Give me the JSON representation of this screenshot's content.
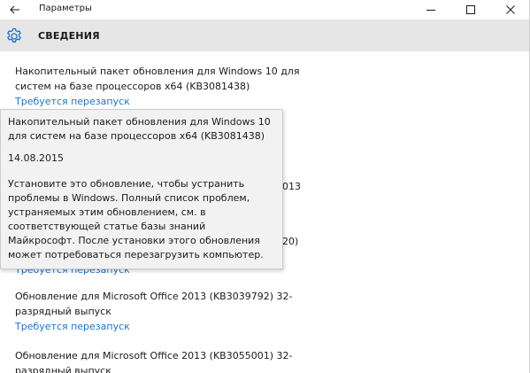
{
  "window": {
    "title": "Параметры",
    "controls": [
      "minimize-icon",
      "maximize-icon",
      "close-icon"
    ]
  },
  "header": {
    "section_title": "СВЕДЕНИЯ",
    "icon": "gear-icon"
  },
  "updates": [
    {
      "title": "Накопительный пакет обновления для Windows 10 для систем на базе процессоров x64 (KB3081438)",
      "status": "Требуется перезапуск"
    },
    {
      "title_tail": "013",
      "status": ""
    },
    {
      "title_tail": "20)",
      "status": "Требуется перезапуск"
    },
    {
      "title": "Обновление для Microsoft Office 2013 (KB3039792) 32-разрядный выпуск",
      "status": "Требуется перезапуск"
    },
    {
      "title": "Обновление для Microsoft Office 2013 (KB3055001) 32-разрядный выпуск",
      "status": ""
    }
  ],
  "tooltip": {
    "title": "Накопительный пакет обновления для Windows 10 для систем на базе процессоров x64 (KB3081438)",
    "date": "14.08.2015",
    "description": "Установите это обновление, чтобы устранить проблемы в Windows. Полный список проблем, устраняемых этим обновлением, см. в соответствующей статье базы знаний Майкрософт. После установки этого обновления может потребоваться перезагрузить компьютер."
  },
  "colors": {
    "accent": "#1e73c6",
    "header_bg": "#e6e6e6",
    "tooltip_bg": "#f2f2f2"
  }
}
